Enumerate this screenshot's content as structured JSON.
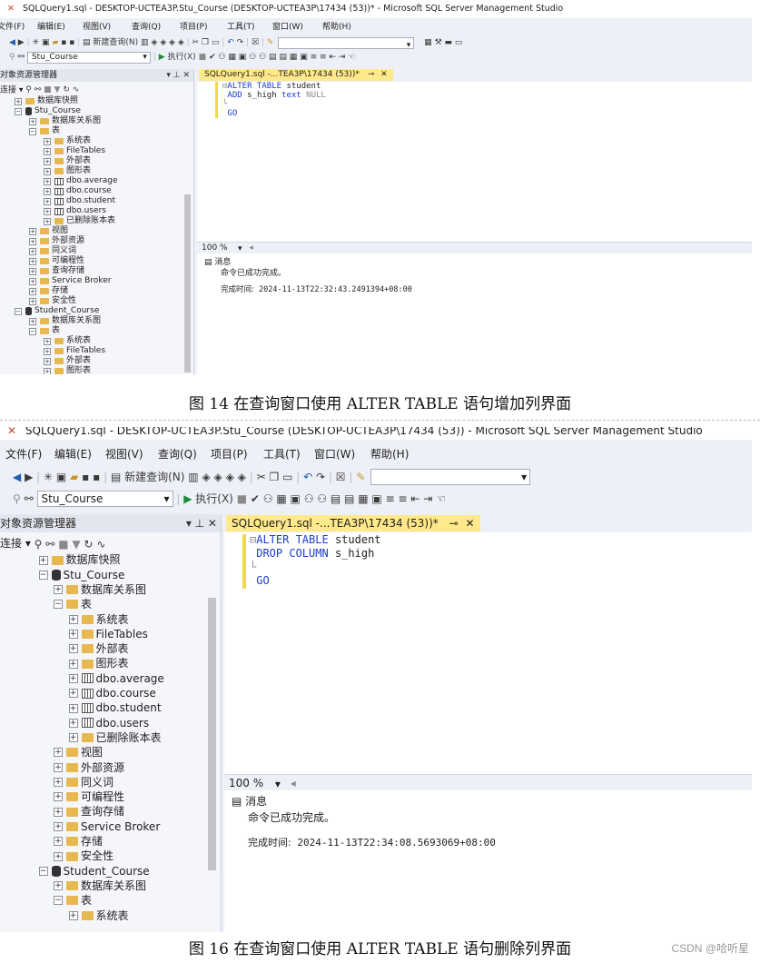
{
  "shot1": {
    "title": "SQLQuery1.sql - DESKTOP-UCTEA3P.Stu_Course (DESKTOP-UCTEA3P\\17434 (53))* - Microsoft SQL Server Management Studio",
    "menu": [
      "文件(F)",
      "编辑(E)",
      "视图(V)",
      "查询(Q)",
      "项目(P)",
      "工具(T)",
      "窗口(W)",
      "帮助(H)"
    ],
    "new_query": "新建查询(N)",
    "database": "Stu_Course",
    "execute": "执行(X)",
    "explorer_title": "对象资源管理器",
    "connect": "连接",
    "tree": [
      "数据库快照",
      "Stu_Course",
      "数据库关系图",
      "表",
      "系统表",
      "FileTables",
      "外部表",
      "图形表",
      "dbo.average",
      "dbo.course",
      "dbo.student",
      "dbo.users",
      "已删除账本表",
      "视图",
      "外部资源",
      "同义词",
      "可编程性",
      "查询存储",
      "Service Broker",
      "存储",
      "安全性",
      "Student_Course",
      "数据库关系图",
      "表",
      "系统表",
      "FileTables",
      "外部表",
      "图形表"
    ],
    "tab": "SQLQuery1.sql -...TEA3P\\17434 (53))*",
    "code": {
      "l1_kw": "ALTER TABLE",
      "l1_rest": " student",
      "l2_kw1": "ADD",
      "l2_mid": " s_high ",
      "l2_kw2": "text",
      "l2_null": " NULL",
      "l4": "GO"
    },
    "zoom": "100 %",
    "messages_label": "消息",
    "msg_done": "命令已成功完成。",
    "msg_time_label": "完成时间:",
    "msg_time": " 2024-11-13T22:32:43.2491394+08:00"
  },
  "caption1": "图 14 在查询窗口使用 ALTER TABLE 语句增加列界面",
  "shot2": {
    "title": "SQLQuery1.sql - DESKTOP-UCTEA3P.Stu_Course (DESKTOP-UCTEA3P\\17434 (53)) - Microsoft SQL Server Management Studio",
    "menu": [
      "文件(F)",
      "编辑(E)",
      "视图(V)",
      "查询(Q)",
      "项目(P)",
      "工具(T)",
      "窗口(W)",
      "帮助(H)"
    ],
    "new_query": "新建查询(N)",
    "database": "Stu_Course",
    "execute": "执行(X)",
    "explorer_title": "对象资源管理器",
    "connect": "连接",
    "tree": [
      "数据库快照",
      "Stu_Course",
      "数据库关系图",
      "表",
      "系统表",
      "FileTables",
      "外部表",
      "图形表",
      "dbo.average",
      "dbo.course",
      "dbo.student",
      "dbo.users",
      "已删除账本表",
      "视图",
      "外部资源",
      "同义词",
      "可编程性",
      "查询存储",
      "Service Broker",
      "存储",
      "安全性",
      "Student_Course",
      "数据库关系图",
      "表",
      "系统表"
    ],
    "tab": "SQLQuery1.sql -...TEA3P\\17434 (53))*",
    "code": {
      "l1_kw": "ALTER TABLE",
      "l1_rest": " student",
      "l2_kw": "DROP COLUMN",
      "l2_rest": " s_high",
      "l4": "GO"
    },
    "zoom": "100 %",
    "messages_label": "消息",
    "msg_done": "命令已成功完成。",
    "msg_time_label": "完成时间:",
    "msg_time": " 2024-11-13T22:34:08.5693069+08:00"
  },
  "caption2": "图 16 在查询窗口使用 ALTER TABLE 语句删除列界面",
  "watermark": "CSDN @哈听星"
}
